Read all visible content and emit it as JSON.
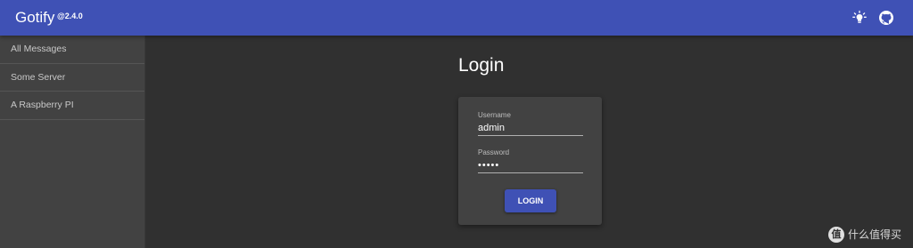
{
  "appbar": {
    "title": "Gotify",
    "version": "@2.4.0",
    "icons": [
      "lightbulb-icon",
      "github-icon"
    ]
  },
  "sidebar": {
    "items": [
      {
        "label": "All Messages"
      },
      {
        "label": "Some Server"
      },
      {
        "label": "A Raspberry PI"
      }
    ]
  },
  "login": {
    "title": "Login",
    "username_label": "Username",
    "username_value": "admin",
    "password_label": "Password",
    "password_value": "•••••",
    "button_label": "LOGIN"
  },
  "watermark": {
    "badge": "值",
    "text": "什么值得买"
  },
  "colors": {
    "primary": "#3f51b5",
    "background": "#303030",
    "surface": "#424242"
  }
}
